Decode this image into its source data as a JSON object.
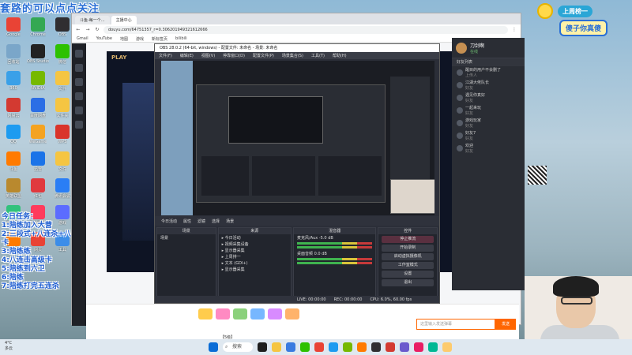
{
  "desktop": {
    "banner": "套路的可以点点关注",
    "icons": [
      {
        "label": "Google",
        "color": "#e94335"
      },
      {
        "label": "Chrome",
        "color": "#34a853"
      },
      {
        "label": "OBS",
        "color": "#302e31"
      },
      {
        "label": "回收站",
        "color": "#7aa6c9"
      },
      {
        "label": "OBS Studio",
        "color": "#222"
      },
      {
        "label": "微信",
        "color": "#2dc100"
      },
      {
        "label": "360",
        "color": "#3aa0e8"
      },
      {
        "label": "NVIDIA",
        "color": "#76b900"
      },
      {
        "label": "文件",
        "color": "#f5c542"
      },
      {
        "label": "网易云",
        "color": "#d33a31"
      },
      {
        "label": "百度网盘",
        "color": "#2b6ee5"
      },
      {
        "label": "文件夹",
        "color": "#f5c542"
      },
      {
        "label": "QQ",
        "color": "#1d9bf0"
      },
      {
        "label": "WeGame",
        "color": "#f4a321"
      },
      {
        "label": "WPS",
        "color": "#d9342b"
      },
      {
        "label": "斗鱼",
        "color": "#ff7a00"
      },
      {
        "label": "迅雷",
        "color": "#1a73e8"
      },
      {
        "label": "文件",
        "color": "#f5c542"
      },
      {
        "label": "英雄联盟",
        "color": "#b9892e"
      },
      {
        "label": "红包",
        "color": "#e0393e"
      },
      {
        "label": "腾讯会议",
        "color": "#2a7ef5"
      },
      {
        "label": "QQ音乐",
        "color": "#31c27c"
      },
      {
        "label": "直播伴侣",
        "color": "#ff3b5c"
      },
      {
        "label": "游戏",
        "color": "#5b6cff"
      },
      {
        "label": "雷神",
        "color": "#ff7a00"
      },
      {
        "label": "网页",
        "color": "#e94335"
      },
      {
        "label": "工具",
        "color": "#3c8de8"
      }
    ],
    "overlay_lines": [
      "今日任务：",
      "1:陪练加入大营",
      "2:三段式+八连杀+八张高级卡+七张特卡",
      "3:陪练练",
      "4:八连击高级卡",
      "5:陪练到六卫",
      "6:陪练",
      "7:陪练打完五连杀"
    ]
  },
  "browser": {
    "tabs": [
      "斗鱼-每一个...",
      "主播中心"
    ],
    "address": "douyu.com/64751357_r=0.306201949321612666",
    "bookmarks": [
      "Gmail",
      "YouTube",
      "地图",
      "游戏",
      "新标签页",
      "bilibili"
    ]
  },
  "douyu": {
    "sidebar_items": [
      "首页",
      "直播",
      "关注",
      "分区",
      "游戏",
      "赛事"
    ],
    "play_label": "PLAY",
    "bottom_gifts": [
      {
        "color": "#ffcc4d"
      },
      {
        "color": "#ff8ac2"
      },
      {
        "color": "#8bd17c"
      },
      {
        "color": "#77b7ff"
      },
      {
        "color": "#d88bff"
      },
      {
        "color": "#ffb36b"
      }
    ],
    "send_placeholder": "这里输入发送弹幕",
    "send_label": "发送",
    "room_info": "【5级】"
  },
  "obs": {
    "title": "OBS 28.0.2 (64-bit, windows) - 配置文件: 未命名 - 场景: 未命名",
    "menu": [
      "文件(F)",
      "编辑(E)",
      "视图(V)",
      "停靠窗口(D)",
      "配置文件(P)",
      "场景集合(S)",
      "工具(T)",
      "帮助(H)"
    ],
    "scene_bar": [
      "今日活动",
      "属性",
      "滤镜",
      "选择",
      "场景"
    ],
    "panels": {
      "scenes_title": "场景",
      "scenes": [
        "场景"
      ],
      "sources_title": "来源",
      "sources": [
        "今日活动",
        "视频采集设备",
        "显示器采集",
        "上周排一",
        "文本 (GDI+)",
        "显示器采集"
      ],
      "mixer_title": "混音器",
      "mixer": [
        "麦克风/Aux",
        "桌面音频"
      ],
      "mixer_levels": [
        "-5.0 dB",
        "0.0 dB"
      ],
      "controls_title": "控件",
      "controls": [
        "停止推流",
        "开始录制",
        "启动虚拟摄像机",
        "工作室模式",
        "设置",
        "退出"
      ]
    },
    "status": [
      "LIVE: 00:00:00",
      "REC: 00:00:00",
      "CPU: 6.0%, 60.00 fps"
    ]
  },
  "chat": {
    "streamer_name": "刀剑啊",
    "streamer_status": "在线",
    "tab": "好友列表",
    "items": [
      "醒目的用户不会删了",
      "上传人",
      "江湖大佬队长",
      "好友",
      "遇见你真好",
      "好友",
      "一起来玩",
      "好友",
      "游戏玩家",
      "好友",
      "好友7",
      "好友",
      "欢迎",
      "好友"
    ]
  },
  "overlay_tr": {
    "line1": "上周榜一",
    "line2": "傻子你真傻"
  },
  "taskbar": {
    "weather_temp": "4°C",
    "weather_desc": "多云",
    "search": "搜索",
    "icons": [
      {
        "color": "#0a6cd6"
      },
      {
        "color": "#1e1e1e"
      },
      {
        "color": "#f5c542"
      },
      {
        "color": "#3a7be0"
      },
      {
        "color": "#2dc100"
      },
      {
        "color": "#e94335"
      },
      {
        "color": "#1d9bf0"
      },
      {
        "color": "#76b900"
      },
      {
        "color": "#ff7a00"
      },
      {
        "color": "#302e31"
      },
      {
        "color": "#d33a31"
      },
      {
        "color": "#6a5acd"
      },
      {
        "color": "#e91e63"
      },
      {
        "color": "#00b894"
      },
      {
        "color": "#fdcb6e"
      }
    ]
  }
}
